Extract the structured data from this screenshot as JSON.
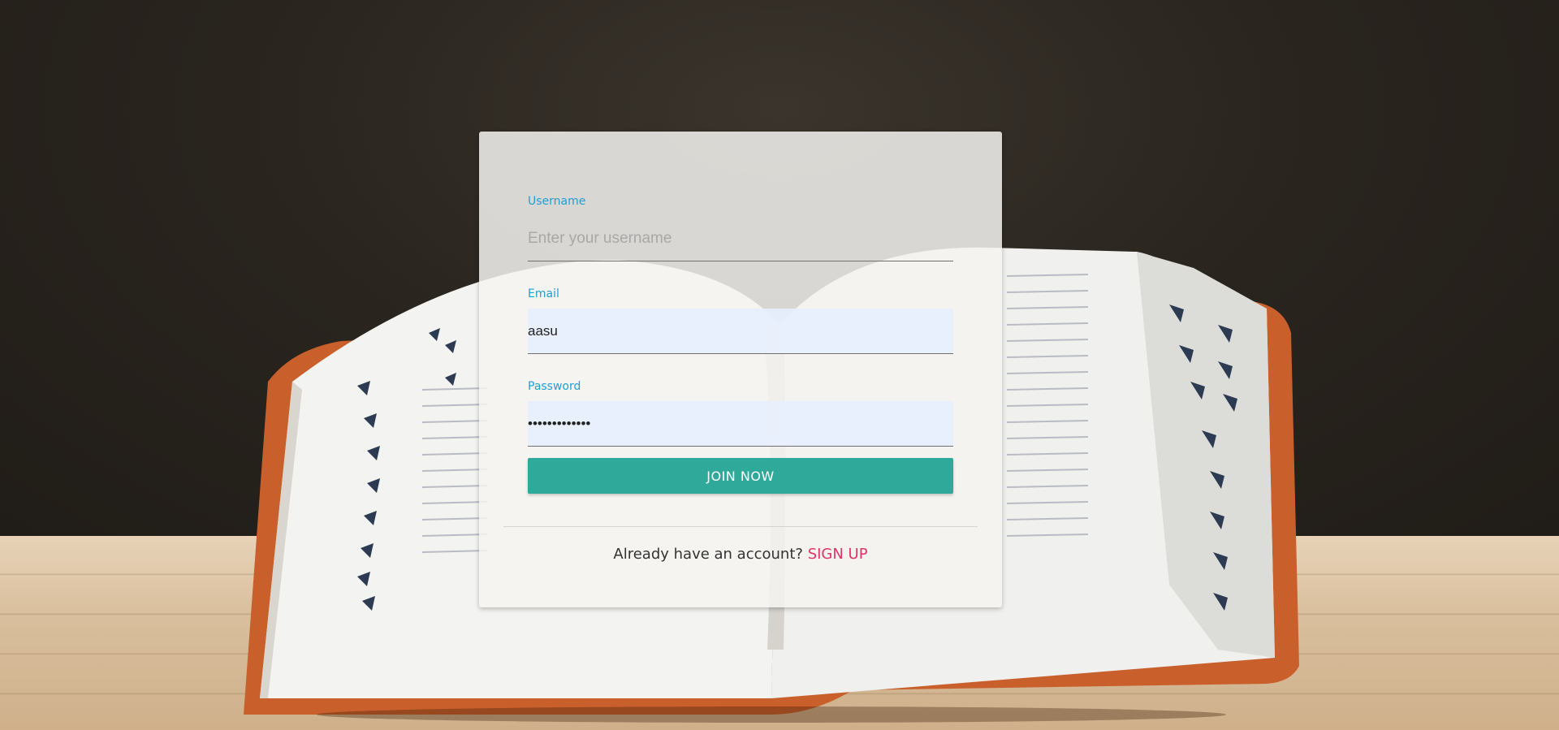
{
  "form": {
    "username": {
      "label": "Username",
      "placeholder": "Enter your username",
      "value": ""
    },
    "email": {
      "label": "Email",
      "placeholder": "",
      "value": "aasu"
    },
    "password": {
      "label": "Password",
      "value": "•••••••••••••"
    },
    "submit_label": "JOIN NOW"
  },
  "footer": {
    "prompt": "Already have an account?",
    "link_label": "SIGN UP"
  },
  "colors": {
    "label_accent": "#1e9fd6",
    "button": "#2fa99a",
    "link": "#e0336a",
    "autofill_bg": "#e8f0fe"
  }
}
